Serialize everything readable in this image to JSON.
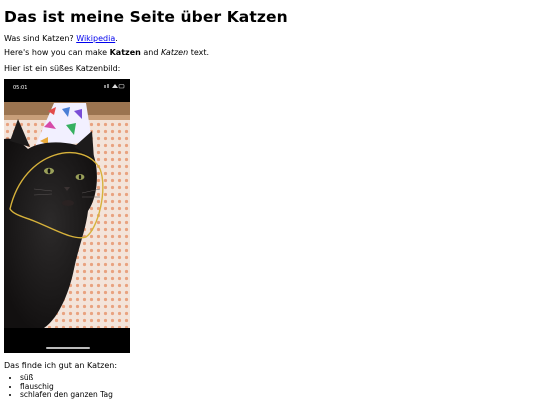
{
  "page": {
    "title": "Das ist meine Seite über Katzen",
    "intro_prefix": "Was sind Katzen? ",
    "intro_link": "Wikipedia",
    "intro_suffix": ".",
    "format_prefix": "Here's how you can make ",
    "format_bold": "Katzen",
    "format_middle": " and ",
    "format_italic": "Katzen",
    "format_suffix": " text.",
    "image_caption": "Hier ist ein süßes Katzenbild:",
    "list_heading": "Das finde ich gut an Katzen:",
    "list_items": [
      "süß",
      "flauschig",
      "schlafen den ganzen Tag"
    ]
  },
  "photo": {
    "status_time": "05:01"
  }
}
